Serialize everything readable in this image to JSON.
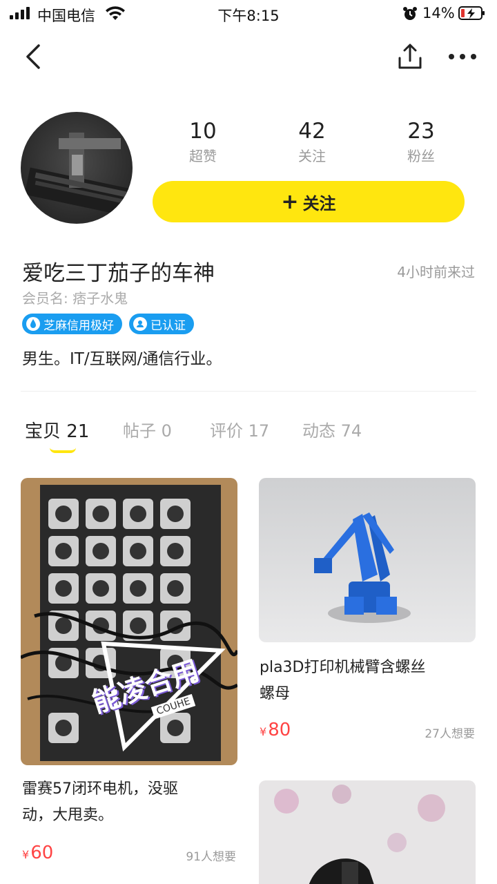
{
  "status": {
    "carrier": "中国电信",
    "time": "下午8:15",
    "battery": "14%"
  },
  "profile": {
    "stats": [
      {
        "num": "10",
        "label": "超赞"
      },
      {
        "num": "42",
        "label": "关注"
      },
      {
        "num": "23",
        "label": "粉丝"
      }
    ],
    "follow_label": "关注",
    "nickname": "爱吃三丁茄子的车神",
    "last_seen": "4小时前来过",
    "member": "会员名: 痞子水鬼",
    "badges": [
      "芝麻信用极好",
      "已认证"
    ],
    "bio": "男生。IT/互联网/通信行业。"
  },
  "tabs": [
    {
      "label": "宝贝",
      "count": "21"
    },
    {
      "label": "帖子",
      "count": "0"
    },
    {
      "label": "评价",
      "count": "17"
    },
    {
      "label": "动态",
      "count": "74"
    }
  ],
  "items": [
    {
      "title_line1": "雷赛57闭环电机，没驱",
      "title_line2": "动，大甩卖。",
      "price": "60",
      "wants": "91人想要",
      "watermark": "能凌合用",
      "watermark_sub": "COUHE"
    },
    {
      "title_line1": "pla3D打印机械臂含螺丝",
      "title_line2": "螺母",
      "price": "80",
      "wants": "27人想要"
    }
  ],
  "currency": "¥",
  "colors": {
    "accent": "#ffe60f",
    "price": "#ff4444",
    "badge": "#1a9df0"
  }
}
